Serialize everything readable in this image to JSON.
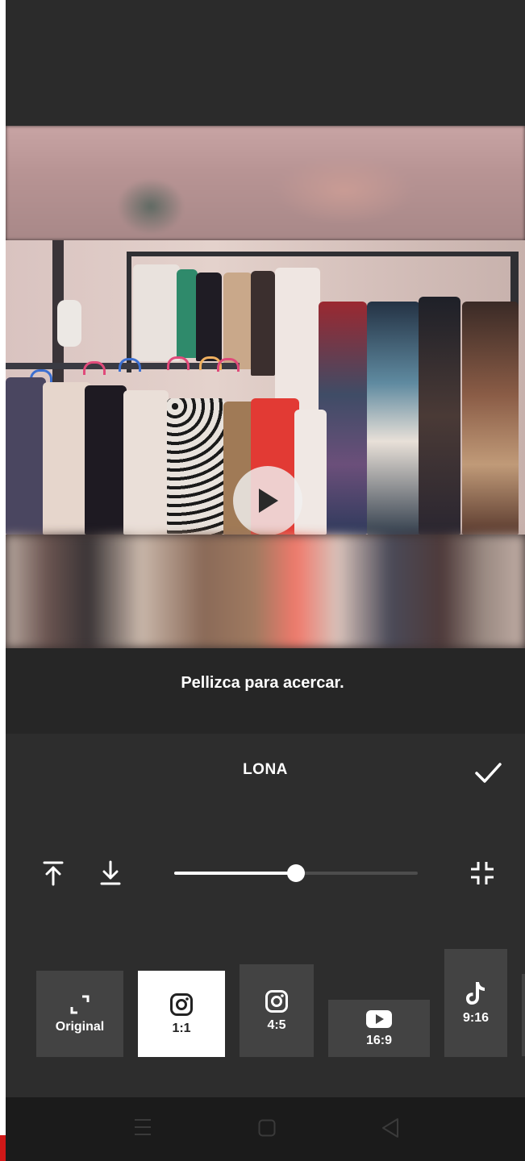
{
  "hint": "Pellizca para acercar.",
  "panel": {
    "title": "LONA",
    "zoom_level": 0.5
  },
  "ratios": [
    {
      "label": "Original",
      "icon": "expand-corners-icon",
      "selected": false
    },
    {
      "label": "1:1",
      "icon": "instagram-icon",
      "selected": true
    },
    {
      "label": "4:5",
      "icon": "instagram-icon",
      "selected": false
    },
    {
      "label": "16:9",
      "icon": "youtube-icon",
      "selected": false
    },
    {
      "label": "9:16",
      "icon": "tiktok-icon",
      "selected": false
    }
  ],
  "colors": {
    "panel_bg": "#2d2d2d",
    "tile_bg": "#434343",
    "selected_tile_bg": "#ffffff",
    "accent": "#ffffff"
  }
}
